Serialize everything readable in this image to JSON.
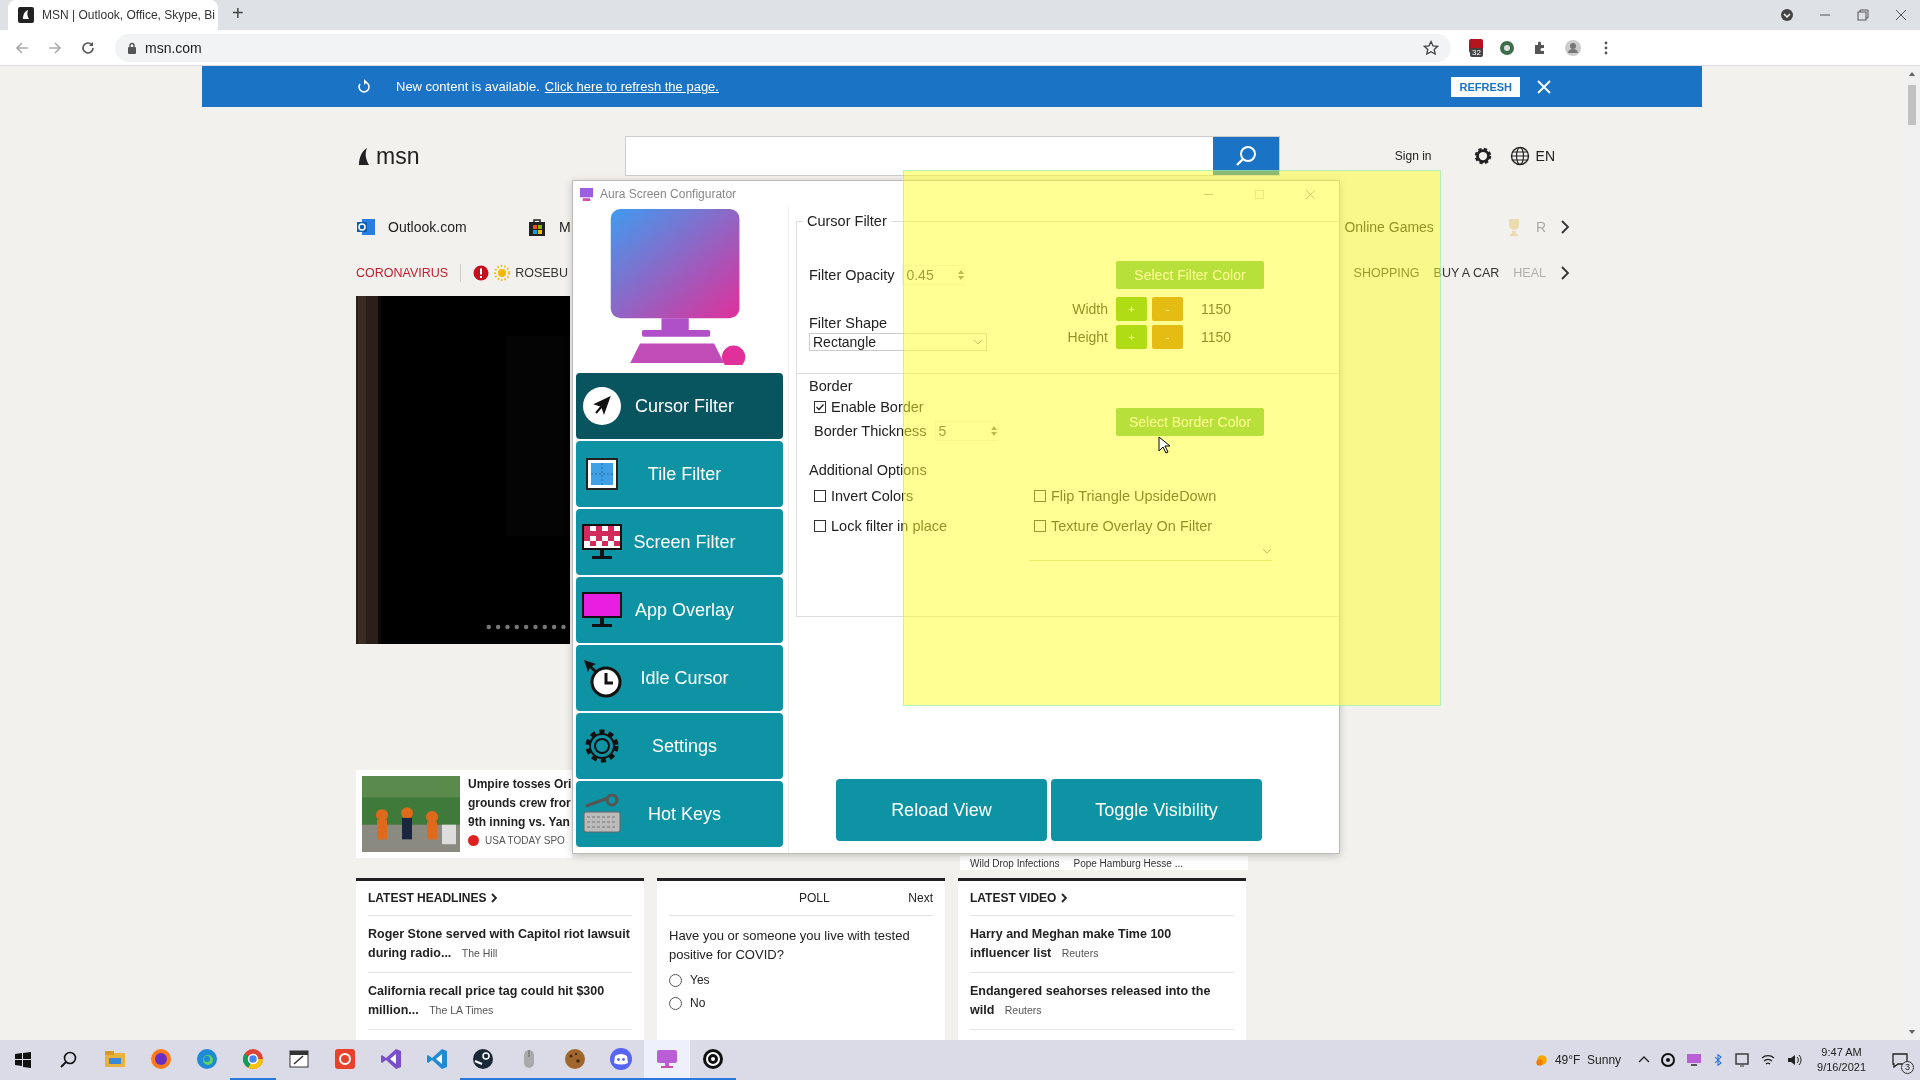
{
  "browser": {
    "tab_title": "MSN | Outlook, Office, Skype, Bi",
    "new_tab": "+",
    "address": "msn.com",
    "extension_badge": "32"
  },
  "banner": {
    "message": "New content is available.",
    "link": "Click here to refresh the page.",
    "button": "REFRESH"
  },
  "header": {
    "logo": "msn",
    "sign_in": "Sign in",
    "language": "EN"
  },
  "nav_links": {
    "left": [
      "Outlook.com",
      "M"
    ],
    "right": [
      "Online Games",
      "R"
    ]
  },
  "topics": {
    "highlight": "CORONAVIRUS",
    "weather": "ROSEBU",
    "right": [
      "SHOPPING",
      "BUY A CAR",
      "HEAL"
    ]
  },
  "umpire": {
    "lines": [
      "Umpire tosses Ori",
      "grounds crew fror",
      "9th inning vs. Yan"
    ],
    "source": "USA TODAY SPO"
  },
  "hidden_card": [
    "Wild Drop Infections",
    "Pope Hamburg Hesse ..."
  ],
  "headlines": {
    "title": "LATEST HEADLINES",
    "items": [
      {
        "text": "Roger Stone served with Capitol riot lawsuit during radio...",
        "source": "The Hill"
      },
      {
        "text": "California recall price tag could hit $300 million...",
        "source": "The LA Times"
      }
    ]
  },
  "poll": {
    "title": "POLL",
    "next": "Next",
    "question": "Have you or someone you live with tested positive for COVID?",
    "options": [
      {
        "label": "Yes",
        "selected": false
      },
      {
        "label": "No",
        "selected": false
      }
    ]
  },
  "video": {
    "title": "LATEST VIDEO",
    "items": [
      {
        "text": "Harry and Meghan make Time 100 influencer list",
        "source": "Reuters"
      },
      {
        "text": "Endangered seahorses released into the wild",
        "source": "Reuters"
      }
    ]
  },
  "app": {
    "title": "Aura Screen Configurator",
    "nav": [
      {
        "label": "Cursor Filter",
        "selected": true
      },
      {
        "label": "Tile Filter",
        "selected": false
      },
      {
        "label": "Screen Filter",
        "selected": false
      },
      {
        "label": "App Overlay",
        "selected": false
      },
      {
        "label": "Idle Cursor",
        "selected": false
      },
      {
        "label": "Settings",
        "selected": false
      },
      {
        "label": "Hot Keys",
        "selected": false
      }
    ],
    "group_title": "Cursor Filter",
    "opacity_label": "Filter Opacity",
    "opacity_value": "0.45",
    "filter_color_button": "Select Filter Color",
    "shape_label": "Filter Shape",
    "shape_value": "Rectangle",
    "size_rows": [
      {
        "label": "Width",
        "plus": "+",
        "minus": "-",
        "value": "1150"
      },
      {
        "label": "Height",
        "plus": "+",
        "minus": "-",
        "value": "1150"
      }
    ],
    "border_label": "Border",
    "enable_border": {
      "label": "Enable Border",
      "checked": true
    },
    "thickness_label": "Border Thickness",
    "thickness_value": "5",
    "border_color_button": "Select Border Color",
    "additional_label": "Additional Options",
    "options": [
      {
        "label": "Invert Colors",
        "checked": false
      },
      {
        "label": "Flip Triangle UpsideDown",
        "checked": false
      },
      {
        "label": "Lock filter in place",
        "checked": false
      },
      {
        "label": "Texture Overlay On Filter",
        "checked": false
      }
    ],
    "reload_button": "Reload View",
    "toggle_button": "Toggle Visibility"
  },
  "taskbar": {
    "apps": [
      {
        "running": false,
        "selected": false
      },
      {
        "running": false,
        "selected": false
      },
      {
        "running": false,
        "selected": false
      },
      {
        "running": true,
        "selected": false
      },
      {
        "running": false,
        "selected": false
      },
      {
        "running": false,
        "selected": false
      },
      {
        "running": false,
        "selected": false
      },
      {
        "running": false,
        "selected": false
      },
      {
        "running": true,
        "selected": false
      },
      {
        "running": true,
        "selected": false
      },
      {
        "running": true,
        "selected": false
      },
      {
        "running": true,
        "selected": false
      },
      {
        "running": true,
        "selected": true
      },
      {
        "running": true,
        "selected": false
      }
    ],
    "weather": "49°F  Sunny",
    "time": "9:47 AM",
    "date": "9/16/2021",
    "notifications": "3"
  }
}
